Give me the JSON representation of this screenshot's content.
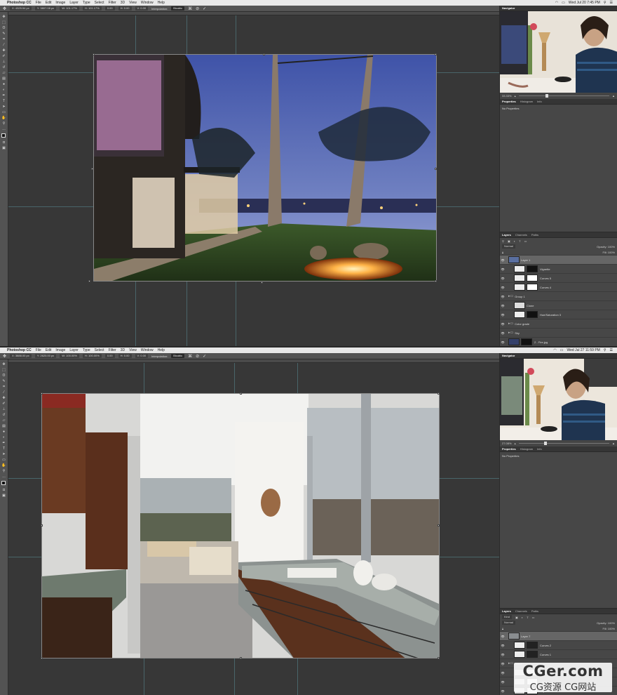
{
  "menubar": {
    "apple": "",
    "app_name": "Photoshop CC",
    "items": [
      "File",
      "Edit",
      "Image",
      "Layer",
      "Type",
      "Select",
      "Filter",
      "3D",
      "View",
      "Window",
      "Help"
    ]
  },
  "top": {
    "clock": "Wed Jul 20  7:45 PM",
    "options": {
      "x": "X: 4325.54 px",
      "y": "Y: 3807.08 px",
      "w": "W: 101.17%",
      "h": "H: 101.17%",
      "angle": "0.00",
      "hskew": "H: 0.00",
      "vskew": "V: 0.00",
      "interp_label": "Interpolation:",
      "interp_mode": "Bicubic"
    },
    "panels": {
      "navigator_tab": "Navigator",
      "zoom": "33.33%",
      "properties_tabs": [
        "Properties",
        "Histogram",
        "Info"
      ],
      "properties_body": "No Properties",
      "layers_tabs": [
        "Layers",
        "Channels",
        "Paths"
      ],
      "blend_mode": "Normal",
      "opacity": "Opacity: 100%",
      "fill": "Fill: 100%",
      "layers": [
        {
          "name": "Layer 1",
          "selected": true,
          "indent": 0,
          "thumb": "#5a6fa0",
          "mask": null
        },
        {
          "name": "Vignette",
          "selected": false,
          "indent": 1,
          "thumb": "#eeeeee",
          "mask": "#111111"
        },
        {
          "name": "Curves 5",
          "selected": false,
          "indent": 1,
          "thumb": "#eeeeee",
          "mask": "#ffffff"
        },
        {
          "name": "Curves 4",
          "selected": false,
          "indent": 1,
          "thumb": "#eeeeee",
          "mask": "#ffffff"
        },
        {
          "name": "Group 1",
          "selected": false,
          "indent": 0,
          "folder": true
        },
        {
          "name": "Clone",
          "selected": false,
          "indent": 1,
          "thumb": "#dddddd",
          "mask": null
        },
        {
          "name": "Hue/Saturation 3",
          "selected": false,
          "indent": 1,
          "thumb": "#eeeeee",
          "mask": "#111111"
        },
        {
          "name": "Color grade",
          "selected": false,
          "indent": 0,
          "folder": true
        },
        {
          "name": "Sky",
          "selected": false,
          "indent": 0,
          "folder": true
        },
        {
          "name": "2 - Fire.jpg",
          "selected": false,
          "indent": 0,
          "thumb": "#34406a",
          "mask": "#111111"
        }
      ]
    }
  },
  "bottom": {
    "clock": "Wed Jul 27  11:59 PM",
    "options": {
      "x": "X: 3888.00 px",
      "y": "Y: 2620.00 px",
      "w": "W: 100.00%",
      "h": "H: 100.00%",
      "angle": "0.00",
      "hskew": "H: 0.00",
      "vskew": "V: 0.00",
      "interp_label": "Interpolation:",
      "interp_mode": "Bicubic"
    },
    "panels": {
      "navigator_tab": "Navigator",
      "zoom": "27.08%",
      "properties_tabs": [
        "Properties",
        "Histogram",
        "Info"
      ],
      "properties_body": "No Properties",
      "layers_tabs": [
        "Layers",
        "Channels",
        "Paths"
      ],
      "kind": "Kind",
      "blend_mode": "Normal",
      "opacity": "Opacity: 100%",
      "fill": "Fill: 100%",
      "layers": [
        {
          "name": "Layer 7",
          "selected": true,
          "indent": 0,
          "thumb": "#8a8d90",
          "mask": null
        },
        {
          "name": "Curves 2",
          "selected": false,
          "indent": 1,
          "thumb": "#eeeeee",
          "mask": "#222222"
        },
        {
          "name": "Curves 1",
          "selected": false,
          "indent": 1,
          "thumb": "#eeeeee",
          "mask": "#222222"
        },
        {
          "name": "Clone",
          "selected": false,
          "indent": 0,
          "folder": true
        },
        {
          "name": "Layer 6",
          "selected": false,
          "indent": 1,
          "thumb": "#d8d8d8",
          "mask": "#ffffff"
        },
        {
          "name": "Layer 5",
          "selected": false,
          "indent": 1,
          "thumb": "#d8d8d8",
          "mask": "#ffffff"
        },
        {
          "name": "Layer 4",
          "selected": false,
          "indent": 1,
          "thumb": "#d8d8d8",
          "mask": "#ffffff"
        }
      ]
    }
  },
  "watermark": {
    "line1": "CGer.com",
    "line2": "CG资源 CG网站"
  }
}
